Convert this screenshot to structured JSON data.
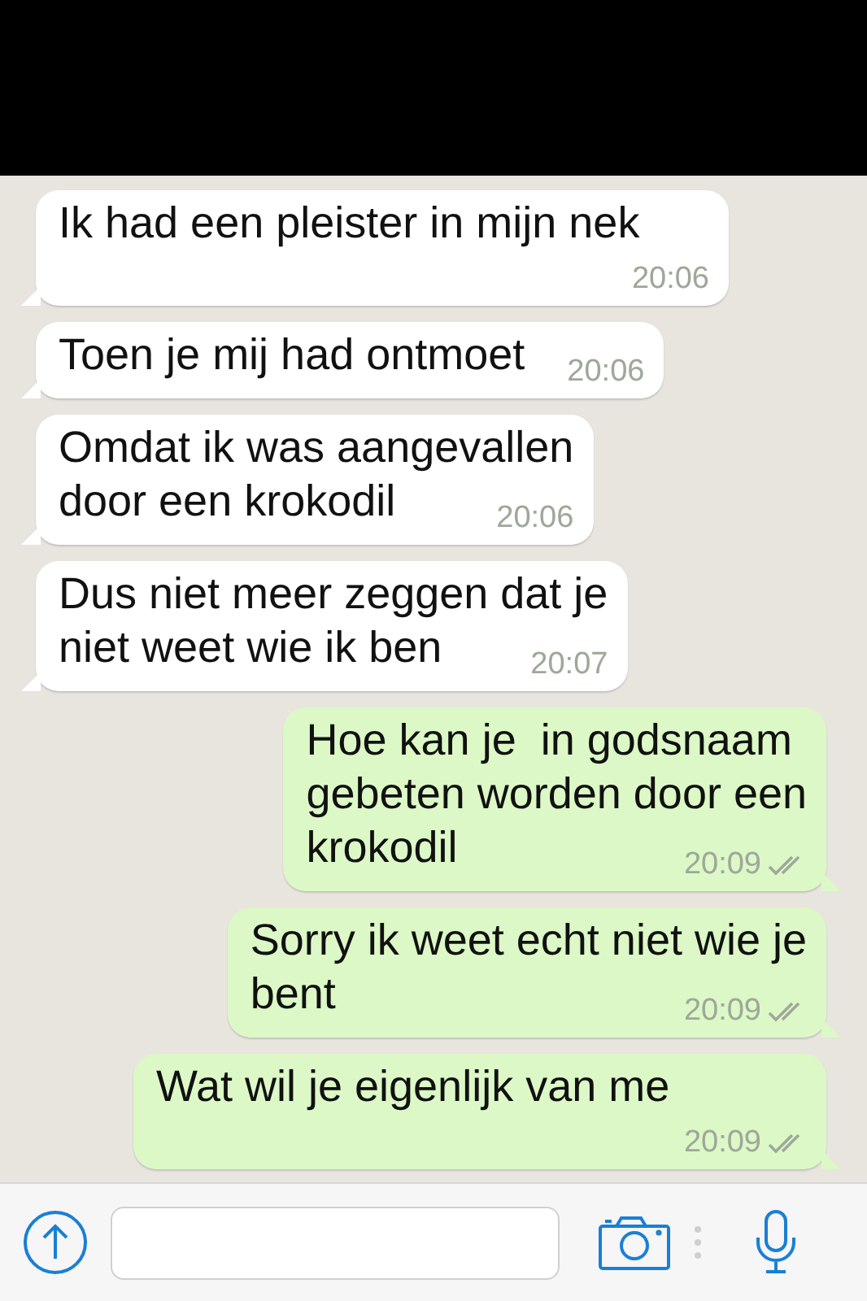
{
  "messages": [
    {
      "kind": "received",
      "lines": [
        "Ik had een pleister in mijn nek"
      ],
      "time": "20:06"
    },
    {
      "kind": "received",
      "lines": [
        "Toen je mij had ontmoet"
      ],
      "time": "20:06"
    },
    {
      "kind": "received",
      "lines": [
        "Omdat ik was aangevallen",
        "door een krokodil"
      ],
      "time": "20:06"
    },
    {
      "kind": "received",
      "lines": [
        "Dus niet meer zeggen dat je",
        "niet weet wie ik ben"
      ],
      "time": "20:07"
    },
    {
      "kind": "sent",
      "lines": [
        "Hoe kan je  in godsnaam",
        "gebeten worden door een",
        "krokodil"
      ],
      "time": "20:09",
      "delivered": true
    },
    {
      "kind": "sent",
      "lines": [
        "Sorry ik weet echt niet wie je",
        "bent"
      ],
      "time": "20:09",
      "delivered": true
    },
    {
      "kind": "sent",
      "lines": [
        "Wat wil je eigenlijk van me"
      ],
      "time": "20:09",
      "delivered": true
    }
  ]
}
